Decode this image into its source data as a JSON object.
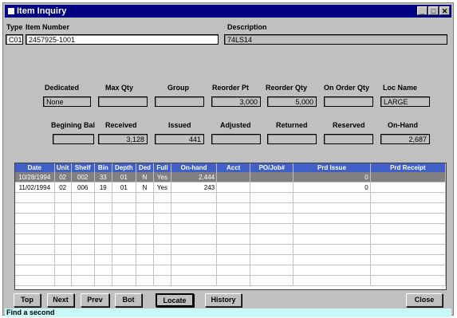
{
  "window": {
    "title": "Item Inquiry",
    "controls": [
      "_",
      "□",
      "✕"
    ]
  },
  "header": {
    "type_label": "Type",
    "item_number_label": "Item Number",
    "description_label": "Description",
    "type_value": "C01",
    "item_number_value": "2457925-1001",
    "description_value": "74LS14"
  },
  "row1": {
    "labels": [
      "Dedicated",
      "Max Qty",
      "Group",
      "Reorder Pt",
      "Reorder Qty",
      "On Order Qty",
      "Loc Name"
    ],
    "values": [
      "None",
      "",
      "",
      "3,000",
      "5,000",
      "",
      "LARGE"
    ]
  },
  "row2": {
    "labels": [
      "Begining Bal",
      "Received",
      "Issued",
      "Adjusted",
      "Returned",
      "Reserved",
      "On-Hand"
    ],
    "values": [
      "",
      "3,128",
      "441",
      "",
      "",
      "",
      "2,687"
    ]
  },
  "grid": {
    "columns": [
      "Date",
      "Unit",
      "Shelf",
      "Bin",
      "Depth",
      "Ded",
      "Full",
      "On-hand",
      "Acct",
      "PO/Job#",
      "Prd Issue",
      "Prd Receipt"
    ],
    "rows": [
      [
        "10/28/1994",
        "02",
        "002",
        "33",
        "01",
        "N",
        "Yes",
        "2,444",
        "",
        "",
        "0",
        ""
      ],
      [
        "11/02/1994",
        "02",
        "006",
        "19",
        "01",
        "N",
        "Yes",
        "243",
        "",
        "",
        "0",
        ""
      ]
    ]
  },
  "buttons": {
    "top": "Top",
    "next": "Next",
    "prev": "Prev",
    "bot": "Bot",
    "locate": "Locate",
    "history": "History",
    "close": "Close"
  },
  "status": "Find a second"
}
